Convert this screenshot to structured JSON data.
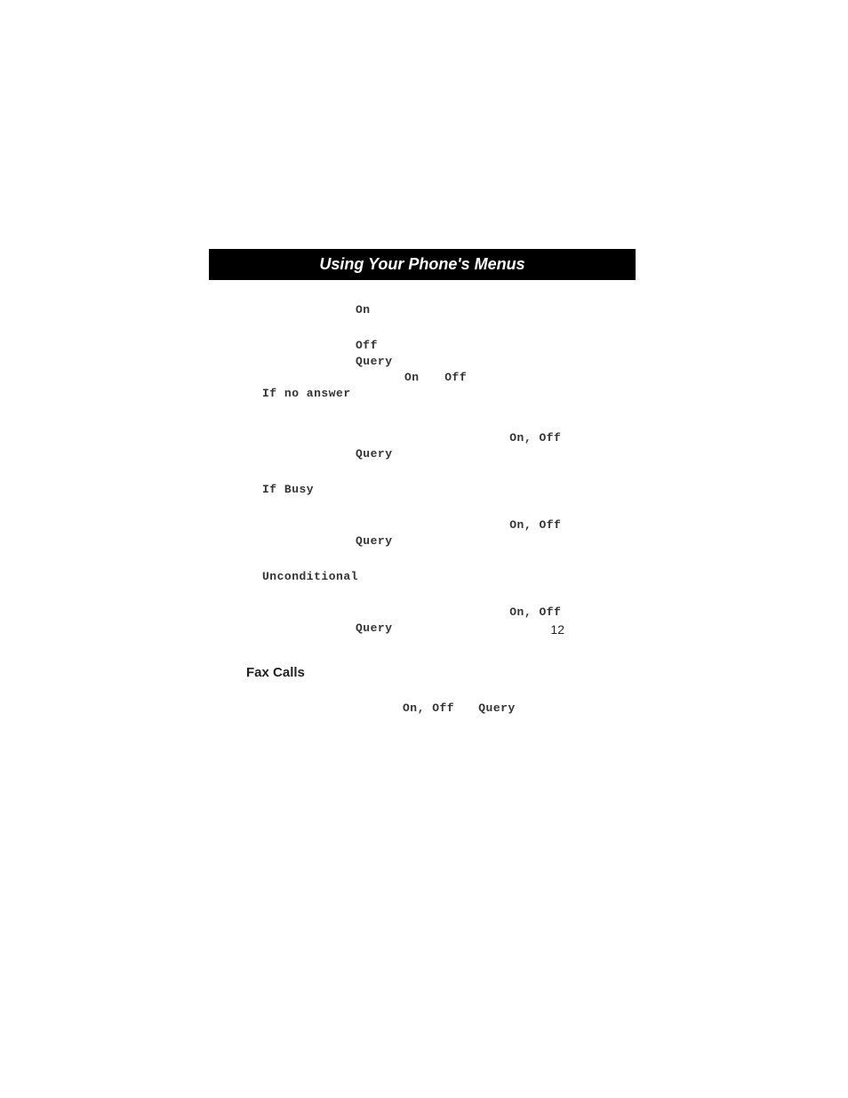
{
  "header": {
    "title": "Using Your Phone's Menus"
  },
  "tokens": {
    "on": "On",
    "off": "Off",
    "query": "Query",
    "on_off": "On, Off"
  },
  "sections": {
    "if_no_answer": "If no answer",
    "if_busy": "If Busy",
    "unconditional": "Unconditional",
    "fax_calls": "Fax Calls"
  },
  "page_number": "12"
}
